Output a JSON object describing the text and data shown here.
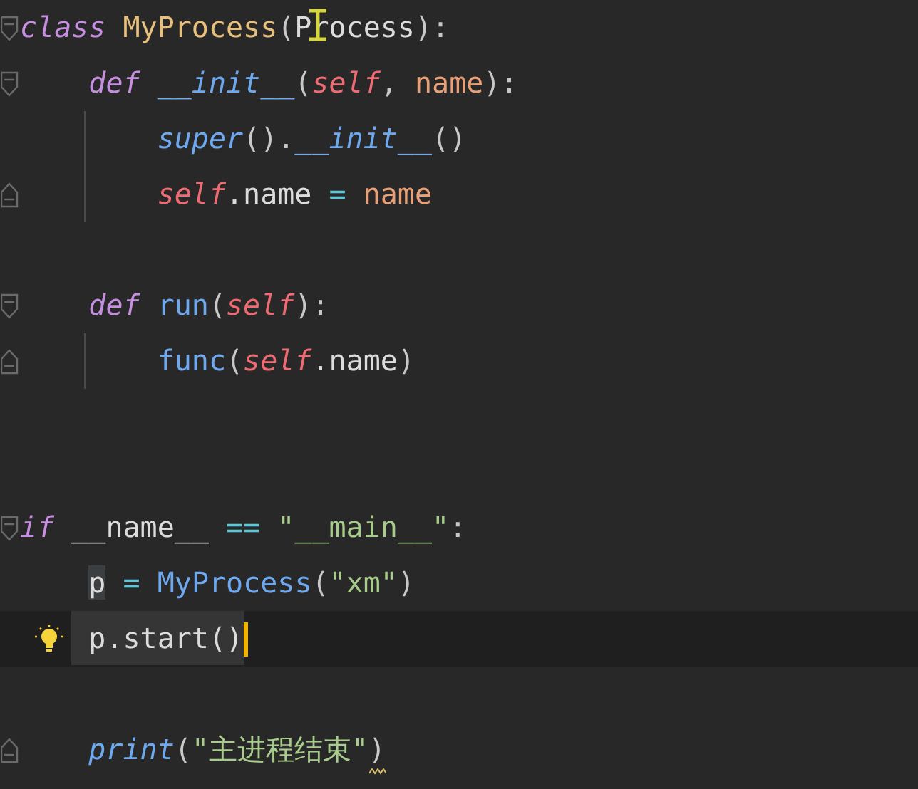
{
  "editor": {
    "lines": [
      {
        "fold_open": true,
        "tokens": [
          {
            "text": "class ",
            "kind": "keyword"
          },
          {
            "text": "MyProcess",
            "kind": "class"
          },
          {
            "text": "(",
            "kind": "punct"
          },
          {
            "text": "Process",
            "kind": "plain",
            "mouse_cursor": true
          },
          {
            "text": "):",
            "kind": "punct"
          }
        ]
      },
      {
        "fold_open": true,
        "tokens": [
          {
            "text": "    def ",
            "kind": "keyword"
          },
          {
            "text": "__init__",
            "kind": "builtin"
          },
          {
            "text": "(",
            "kind": "punct"
          },
          {
            "text": "self",
            "kind": "self"
          },
          {
            "text": ", ",
            "kind": "punct"
          },
          {
            "text": "name",
            "kind": "param"
          },
          {
            "text": "):",
            "kind": "punct"
          }
        ]
      },
      {
        "guide": true,
        "tokens": [
          {
            "text": "        super",
            "kind": "builtin"
          },
          {
            "text": "().",
            "kind": "punct"
          },
          {
            "text": "__init__",
            "kind": "builtin"
          },
          {
            "text": "()",
            "kind": "punct"
          }
        ]
      },
      {
        "fold_close": true,
        "guide": true,
        "tokens": [
          {
            "text": "        self",
            "kind": "self"
          },
          {
            "text": ".name ",
            "kind": "plain"
          },
          {
            "text": "= ",
            "kind": "operator"
          },
          {
            "text": "name",
            "kind": "param"
          }
        ]
      },
      {
        "kind": "blank"
      },
      {
        "fold_open": true,
        "tokens": [
          {
            "text": "    def ",
            "kind": "keyword"
          },
          {
            "text": "run",
            "kind": "function"
          },
          {
            "text": "(",
            "kind": "punct"
          },
          {
            "text": "self",
            "kind": "self"
          },
          {
            "text": "):",
            "kind": "punct"
          }
        ]
      },
      {
        "fold_close": true,
        "guide": true,
        "tokens": [
          {
            "text": "        func",
            "kind": "function"
          },
          {
            "text": "(",
            "kind": "punct"
          },
          {
            "text": "self",
            "kind": "self"
          },
          {
            "text": ".name",
            "kind": "plain"
          },
          {
            "text": ")",
            "kind": "punct"
          }
        ]
      },
      {
        "kind": "blank"
      },
      {
        "kind": "blank"
      },
      {
        "fold_open": true,
        "tokens": [
          {
            "text": "if",
            "kind": "keyword"
          },
          {
            "text": " __name__ ",
            "kind": "plain"
          },
          {
            "text": "== ",
            "kind": "operator"
          },
          {
            "text": "\"__main__\"",
            "kind": "string"
          },
          {
            "text": ":",
            "kind": "punct"
          }
        ]
      },
      {
        "tokens": [
          {
            "text": "    p",
            "kind": "plain",
            "occurrence_highlight": true
          },
          {
            "text": " = ",
            "kind": "operator"
          },
          {
            "text": "MyProcess",
            "kind": "function"
          },
          {
            "text": "(",
            "kind": "punct"
          },
          {
            "text": "\"xm\"",
            "kind": "string"
          },
          {
            "text": ")",
            "kind": "punct"
          }
        ]
      },
      {
        "current": true,
        "caret": true,
        "bulb": true,
        "tokens": [
          {
            "text": "    p.start()",
            "kind": "plain",
            "block_highlight": true
          }
        ]
      },
      {
        "kind": "blank"
      },
      {
        "fold_close": true,
        "tokens": [
          {
            "text": "    print",
            "kind": "builtin"
          },
          {
            "text": "(",
            "kind": "punct"
          },
          {
            "text": "\"主进程结束\"",
            "kind": "string"
          },
          {
            "text": ")",
            "kind": "punct",
            "warning": true
          }
        ]
      }
    ]
  }
}
